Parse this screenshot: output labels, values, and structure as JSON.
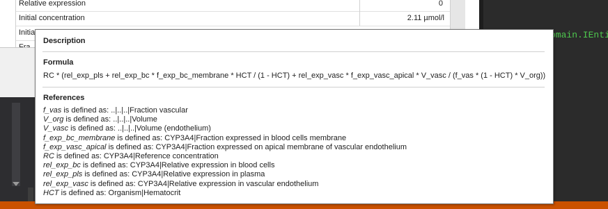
{
  "grid": {
    "rows": [
      {
        "name": "Relative expression",
        "value": "0"
      },
      {
        "name": "Initial concentration",
        "value": "2.11 µmol/l"
      },
      {
        "name": "Initia",
        "value": ""
      },
      {
        "name": "Fra",
        "value": ""
      }
    ]
  },
  "code": {
    "text": "omain.IEntit"
  },
  "tooltip": {
    "description_heading": "Description",
    "formula_heading": "Formula",
    "formula": "RC * (rel_exp_pls + rel_exp_bc * f_exp_bc_membrane * HCT / (1 - HCT) + rel_exp_vasc * f_exp_vasc_apical * V_vasc / (f_vas * (1 - HCT) * V_org))",
    "references_heading": "References",
    "references": [
      {
        "param": "f_vas",
        "definition": " is defined as: ..|..|..|Fraction vascular"
      },
      {
        "param": "V_org",
        "definition": " is defined as: ..|..|..|Volume"
      },
      {
        "param": "V_vasc",
        "definition": " is defined as: ..|..|..|Volume (endothelium)"
      },
      {
        "param": "f_exp_bc_membrane",
        "definition": " is defined as: CYP3A4|Fraction expressed in blood cells membrane"
      },
      {
        "param": "f_exp_vasc_apical",
        "definition": " is defined as: CYP3A4|Fraction expressed on apical membrane of vascular endothelium"
      },
      {
        "param": "RC",
        "definition": " is defined as: CYP3A4|Reference concentration"
      },
      {
        "param": "rel_exp_bc",
        "definition": " is defined as: CYP3A4|Relative expression in blood cells"
      },
      {
        "param": "rel_exp_pls",
        "definition": " is defined as: CYP3A4|Relative expression in plasma"
      },
      {
        "param": "rel_exp_vasc",
        "definition": " is defined as: CYP3A4|Relative expression in vascular endothelium"
      },
      {
        "param": "HCT",
        "definition": " is defined as: Organism|Hematocrit"
      }
    ]
  }
}
